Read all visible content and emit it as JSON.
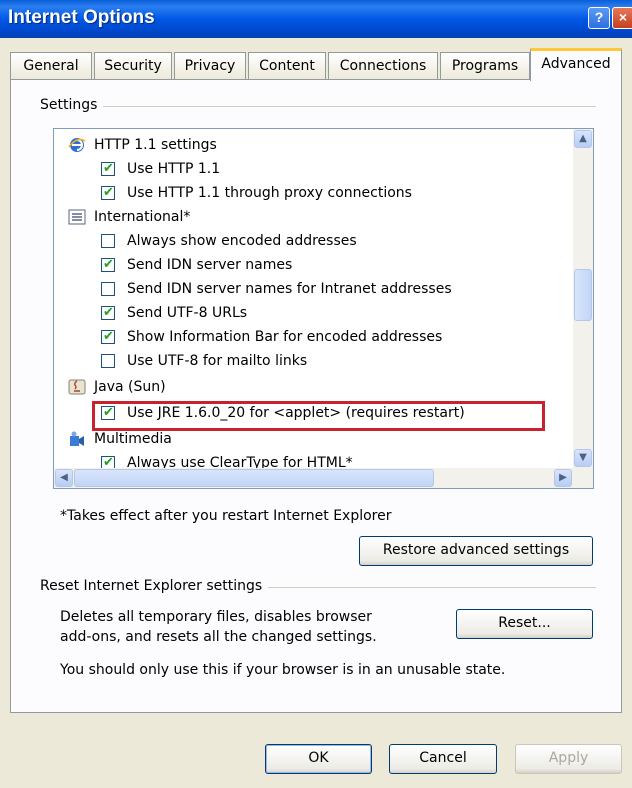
{
  "window": {
    "title": "Internet Options"
  },
  "titlebar": {
    "help_label": "?",
    "close_label": "×"
  },
  "tabs": [
    {
      "label": "General"
    },
    {
      "label": "Security"
    },
    {
      "label": "Privacy"
    },
    {
      "label": "Content"
    },
    {
      "label": "Connections"
    },
    {
      "label": "Programs"
    },
    {
      "label": "Advanced",
      "selected": true
    }
  ],
  "settings": {
    "group_label": "Settings",
    "rows": [
      {
        "kind": "group",
        "icon": "internet-explorer-icon",
        "label": "HTTP 1.1 settings"
      },
      {
        "kind": "check",
        "checked": true,
        "label": "Use HTTP 1.1"
      },
      {
        "kind": "check",
        "checked": true,
        "label": "Use HTTP 1.1 through proxy connections"
      },
      {
        "kind": "group",
        "icon": "international-icon",
        "label": "International*"
      },
      {
        "kind": "check",
        "checked": false,
        "label": "Always show encoded addresses"
      },
      {
        "kind": "check",
        "checked": true,
        "label": "Send IDN server names"
      },
      {
        "kind": "check",
        "checked": false,
        "label": "Send IDN server names for Intranet addresses"
      },
      {
        "kind": "check",
        "checked": true,
        "label": "Send UTF-8 URLs"
      },
      {
        "kind": "check",
        "checked": true,
        "label": "Show Information Bar for encoded addresses"
      },
      {
        "kind": "check",
        "checked": false,
        "label": "Use UTF-8 for mailto links"
      },
      {
        "kind": "group",
        "icon": "java-icon",
        "label": "Java (Sun)"
      },
      {
        "kind": "check",
        "checked": true,
        "label": "Use JRE 1.6.0_20 for <applet> (requires restart)"
      },
      {
        "kind": "group",
        "icon": "multimedia-icon",
        "label": "Multimedia"
      },
      {
        "kind": "check",
        "checked": true,
        "label": "Always use ClearType for HTML*"
      }
    ],
    "footnote": "*Takes effect after you restart Internet Explorer",
    "restore_label": "Restore advanced settings"
  },
  "reset": {
    "group_label": "Reset Internet Explorer settings",
    "description_line1": "Deletes all temporary files, disables browser",
    "description_line2": "add-ons, and resets all the changed settings.",
    "button_label": "Reset...",
    "warning": "You should only use this if your browser is in an unusable state."
  },
  "footer": {
    "ok_label": "OK",
    "cancel_label": "Cancel",
    "apply_label": "Apply"
  },
  "colors": {
    "highlight_box": "#c8232c",
    "checkmark": "#21a121",
    "titlebar": "#0058e6"
  }
}
